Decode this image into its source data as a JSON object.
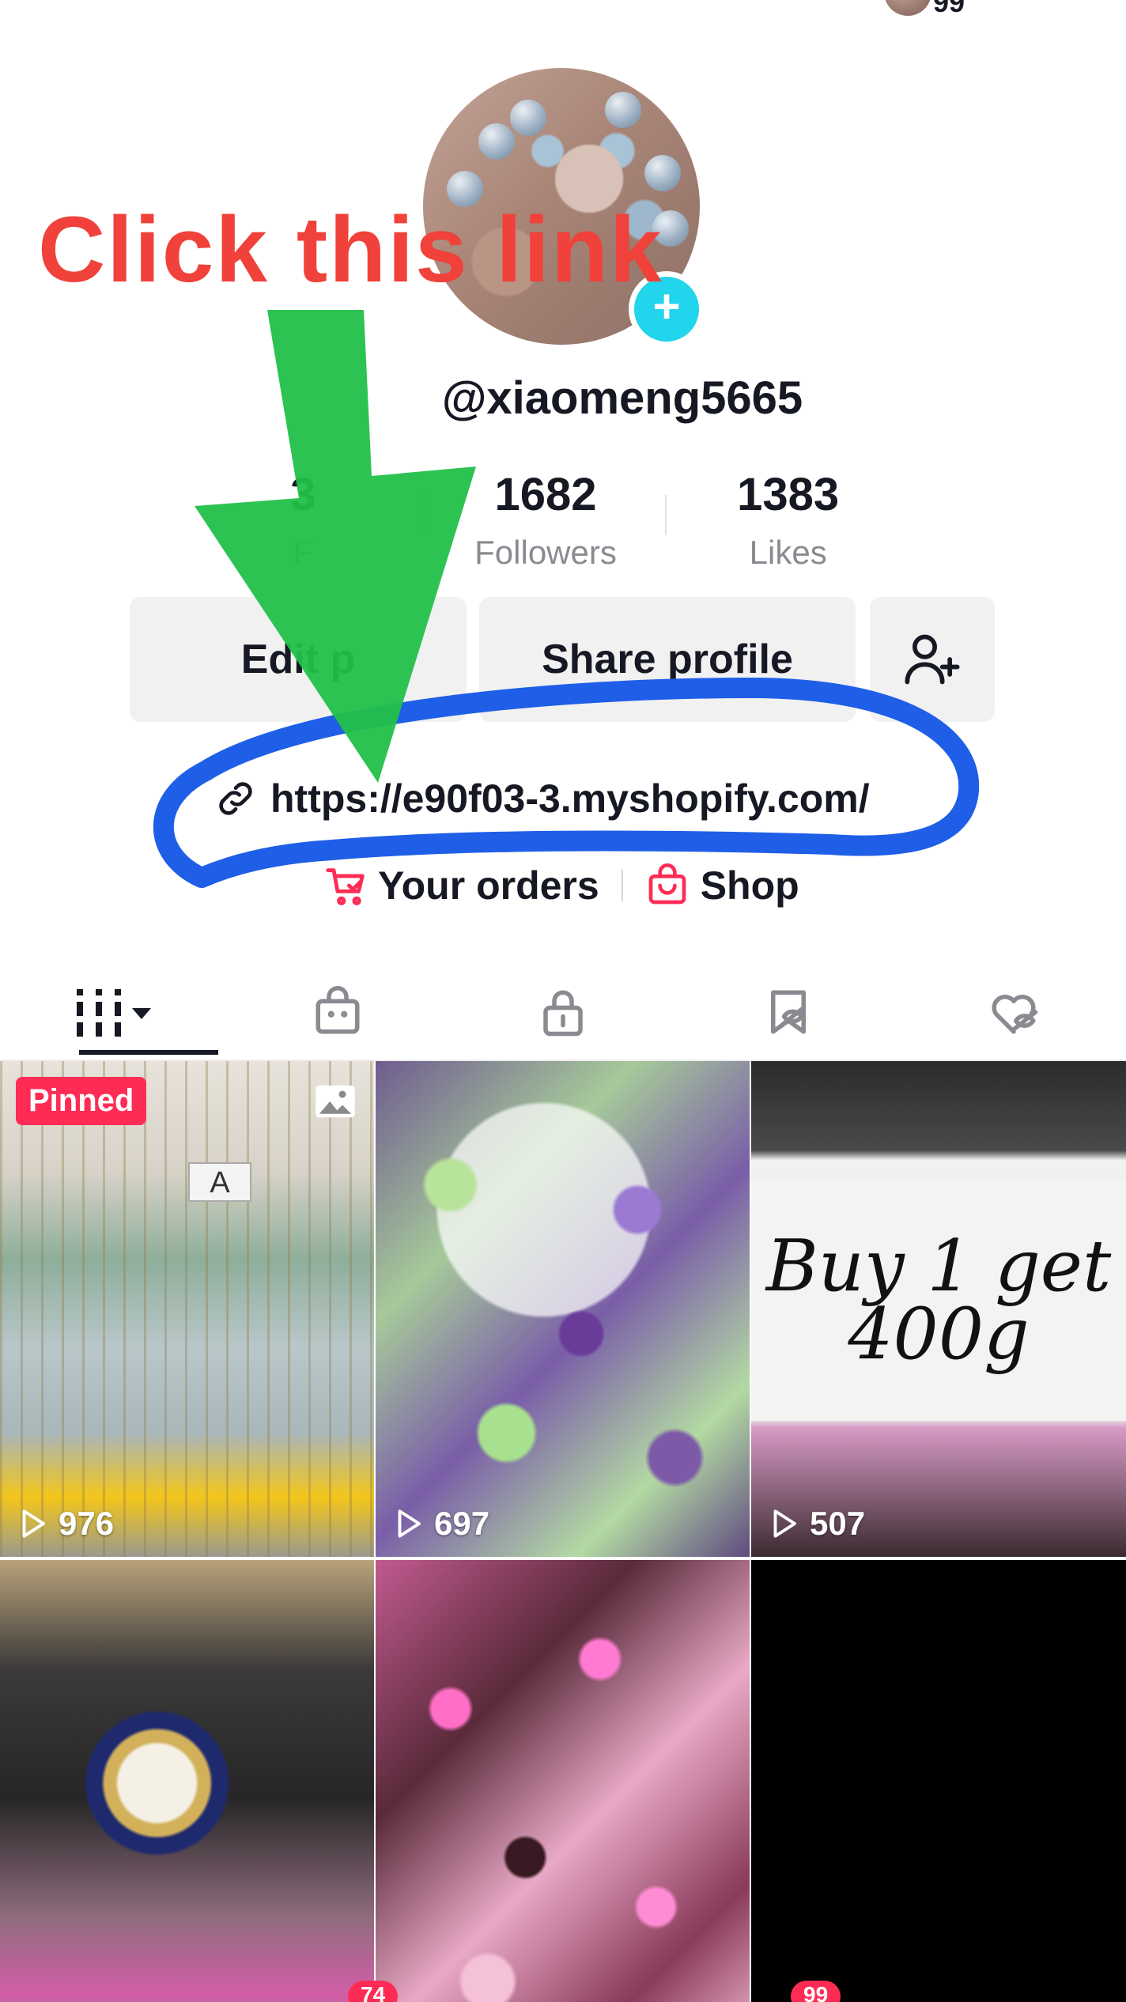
{
  "header": {
    "top_badge": "99"
  },
  "profile": {
    "username": "@xiaomeng5665",
    "stats": [
      {
        "value": "3",
        "label": "F"
      },
      {
        "value": "1682",
        "label": "Followers"
      },
      {
        "value": "1383",
        "label": "Likes"
      }
    ],
    "buttons": {
      "edit_label": "Edit p",
      "share_label": "Share profile"
    },
    "link": "https://e90f03-3.myshopify.com/",
    "orders_label": "Your orders",
    "shop_label": "Shop"
  },
  "tabs": [
    {
      "icon": "grid-icon"
    },
    {
      "icon": "shopping-bag-icon"
    },
    {
      "icon": "lock-icon"
    },
    {
      "icon": "bookmark-hidden-icon"
    },
    {
      "icon": "heart-hidden-icon"
    }
  ],
  "videos": [
    {
      "badge": "Pinned",
      "views": "976",
      "card_label": "A"
    },
    {
      "views": "697"
    },
    {
      "views": "507",
      "sign_text": "Buy 1 get 400g"
    },
    {},
    {},
    {}
  ],
  "bottom_nav": {
    "badge_1": "74",
    "badge_2": "99"
  },
  "annotation": {
    "text": "Click this link",
    "text_color": "#f0413a",
    "arrow_color": "#22c04a",
    "circle_color": "#1f5ee6"
  },
  "colors": {
    "accent": "#fe2c55",
    "avatar_add": "#20d5ec"
  }
}
